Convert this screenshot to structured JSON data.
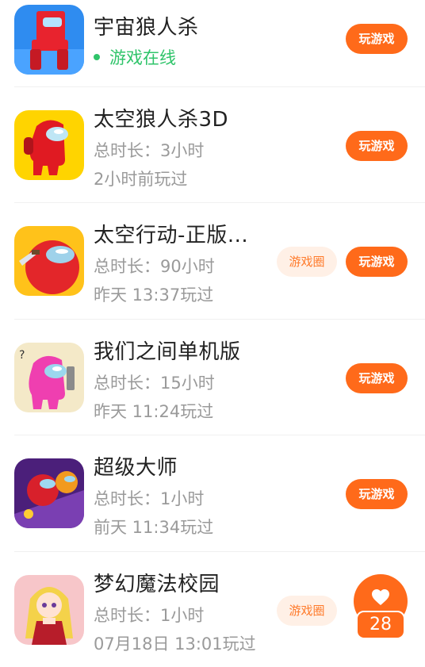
{
  "games": [
    {
      "title": "宇宙狼人杀",
      "status": "游戏在线",
      "play_label": "玩游戏",
      "icon": "red-crewmate-block-icon",
      "colors": {
        "bg": "#2f8cf0",
        "main": "#e8232e"
      }
    },
    {
      "title": "太空狼人杀3D",
      "duration": "总时长：3小时",
      "last_played": "2小时前玩过",
      "play_label": "玩游戏",
      "icon": "red-crewmate-icon",
      "colors": {
        "bg": "#ffd400",
        "main": "#e01a22"
      }
    },
    {
      "title": "太空行动-正版...",
      "duration": "总时长：90小时",
      "last_played": "昨天 13:37玩过",
      "circle_label": "游戏圈",
      "play_label": "玩游戏",
      "icon": "red-crewmate-knife-icon",
      "colors": {
        "bg": "#ffc21a",
        "main": "#e3262a"
      }
    },
    {
      "title": "我们之间单机版",
      "duration": "总时长：15小时",
      "last_played": "昨天 11:24玩过",
      "play_label": "玩游戏",
      "icon": "pink-crewmate-icon",
      "colors": {
        "bg": "#f4e9c8",
        "main": "#ef3fb0"
      }
    },
    {
      "title": "超级大师",
      "duration": "总时长：1小时",
      "last_played": "前天 11:34玩过",
      "play_label": "玩游戏",
      "icon": "crewmates-space-icon",
      "colors": {
        "bg": "#4b1f7a",
        "main": "#d8202b"
      }
    },
    {
      "title": "梦幻魔法校园",
      "duration": "总时长：1小时",
      "last_played": "07月18日 13:01玩过",
      "circle_label": "游戏圈",
      "icon": "anime-girl-icon",
      "colors": {
        "bg": "#f7c6c9",
        "main": "#f4d24a"
      }
    }
  ],
  "favorite": {
    "icon": "heart-icon",
    "count": "28"
  }
}
